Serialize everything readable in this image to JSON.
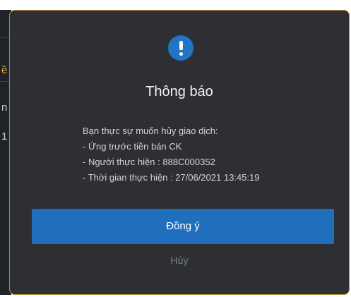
{
  "background": {
    "glyphs": [
      "ề",
      "n",
      "1"
    ]
  },
  "dialog": {
    "icon": "exclamation-circle-icon",
    "title": "Thông báo",
    "message_lines": [
      "Bạn thực sự muốn hủy giao dịch:",
      "- Ứng trước tiền bán CK",
      "- Người thực hiện : 888C000352",
      "- Thời gian thực hiện : 27/06/2021 13:45:19"
    ],
    "confirm_label": "Đồng ý",
    "cancel_label": "Hủy"
  },
  "colors": {
    "modal_bg": "#2d2f33",
    "modal_border": "#b98a3b",
    "accent": "#1f6fbd",
    "icon_bg": "#2474c6",
    "cancel_text": "#7b7e84"
  }
}
